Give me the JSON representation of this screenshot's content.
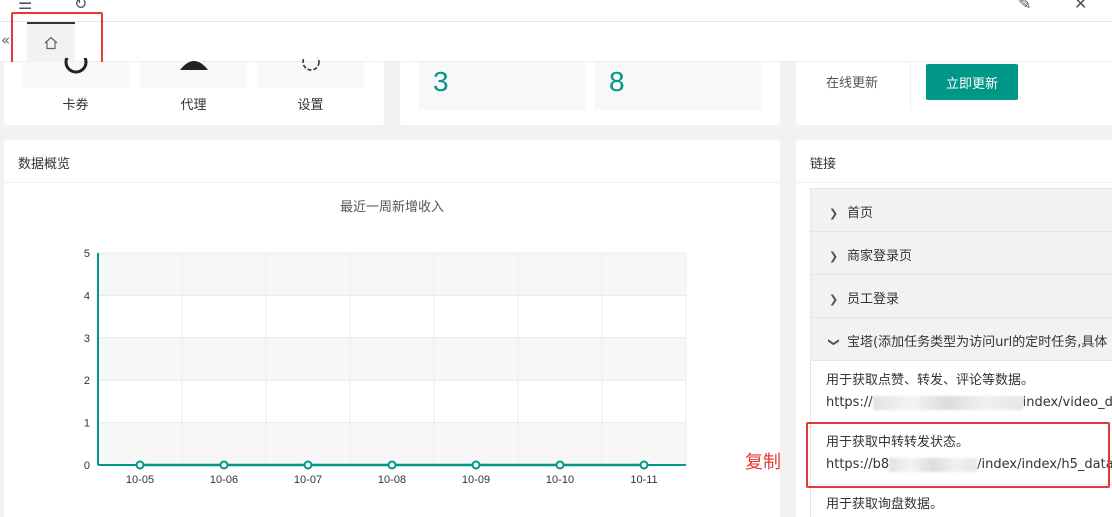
{
  "tabs": {
    "home_icon": "home-icon"
  },
  "shortcuts": [
    {
      "label": "卡券",
      "icon": "card-icon"
    },
    {
      "label": "代理",
      "icon": "agent-icon"
    },
    {
      "label": "设置",
      "icon": "gear-icon"
    }
  ],
  "stats": [
    {
      "value": "3"
    },
    {
      "value": "8"
    }
  ],
  "update": {
    "label": "在线更新",
    "button": "立即更新"
  },
  "overview": {
    "title": "数据概览"
  },
  "chart_data": {
    "type": "line",
    "title": "最近一周新增收入",
    "x": [
      "10-05",
      "10-06",
      "10-07",
      "10-08",
      "10-09",
      "10-10",
      "10-11"
    ],
    "series": [
      {
        "values": [
          0,
          0,
          0,
          0,
          0,
          0,
          0
        ]
      }
    ],
    "ylim": [
      0,
      5
    ],
    "yticks": [
      "0",
      "1",
      "2",
      "3",
      "4",
      "5"
    ],
    "xlabel": "",
    "ylabel": "",
    "grid": true,
    "colors": {
      "line": "#009688"
    }
  },
  "links": {
    "title": "链接",
    "items": [
      {
        "label": "首页"
      },
      {
        "label": "商家登录页"
      },
      {
        "label": "员工登录"
      },
      {
        "label": "宝塔(添加任务类型为访问url的定时任务,具体"
      }
    ],
    "entries": [
      {
        "desc": "用于获取点赞、转发、评论等数据。",
        "url_prefix": "https://",
        "url_suffix": "index/video_da"
      },
      {
        "desc": "用于获取中转转发状态。",
        "url_prefix": "https://b8",
        "url_suffix": "/index/index/h5_data"
      },
      {
        "desc": "用于获取询盘数据。"
      }
    ]
  },
  "annotation": {
    "copy": "复制"
  }
}
